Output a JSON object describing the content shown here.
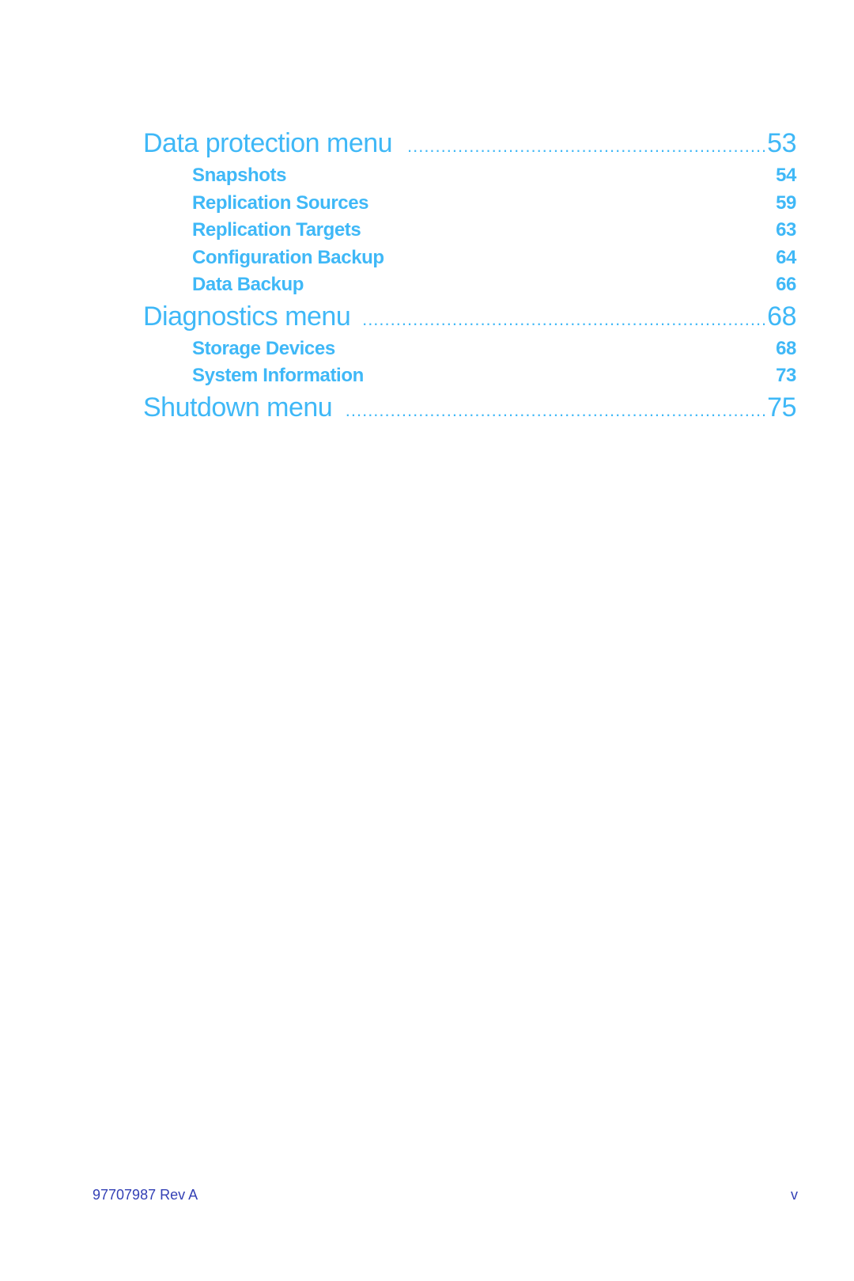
{
  "toc": [
    {
      "level": 1,
      "title": "Data protection menu",
      "page": "53"
    },
    {
      "level": 2,
      "title": "Snapshots",
      "page": "54"
    },
    {
      "level": 2,
      "title": "Replication Sources",
      "page": "59"
    },
    {
      "level": 2,
      "title": "Replication Targets",
      "page": "63"
    },
    {
      "level": 2,
      "title": "Configuration Backup",
      "page": "64"
    },
    {
      "level": 2,
      "title": "Data Backup",
      "page": "66"
    },
    {
      "level": 1,
      "title": "Diagnostics menu",
      "page": "68"
    },
    {
      "level": 2,
      "title": "Storage Devices",
      "page": "68"
    },
    {
      "level": 2,
      "title": "System Information",
      "page": "73"
    },
    {
      "level": 1,
      "title": "Shutdown menu",
      "page": "75"
    }
  ],
  "footer": {
    "doc_id": "97707987 Rev A",
    "page_number": "v"
  },
  "colors": {
    "link": "#3fb8f7",
    "footer": "#3340b5"
  }
}
